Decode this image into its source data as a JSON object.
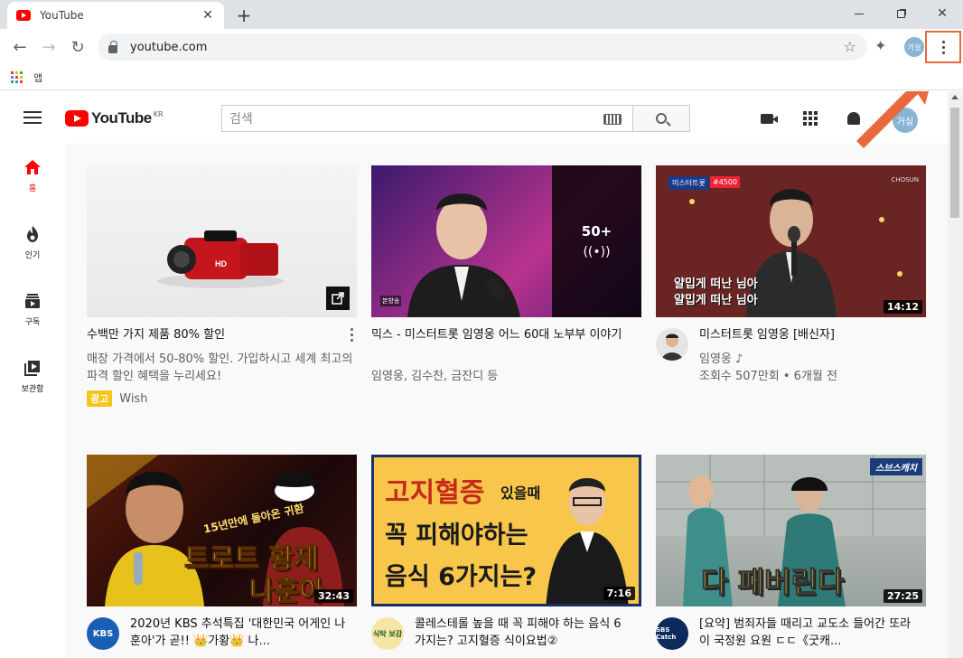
{
  "browser": {
    "tab_title": "YouTube",
    "tab_close": "✕",
    "new_tab": "+",
    "url": "youtube.com",
    "profile_initials": "거실",
    "bookmarks_apps_label": "앱"
  },
  "youtube": {
    "region": "KR",
    "logo_text": "YouTube",
    "search_placeholder": "검색",
    "avatar_initials": "거실",
    "sidebar": [
      {
        "label": "홈"
      },
      {
        "label": "인기"
      },
      {
        "label": "구독"
      },
      {
        "label": "보관함"
      }
    ],
    "videos": [
      {
        "title": "수백만 가지 제품 80% 할인",
        "description": "매장 가격에서 50-80% 할인. 가입하시고 세계 최고의 파격 할인 혜택을 누리세요!",
        "ad_badge": "광고",
        "advertiser": "Wish"
      },
      {
        "title": "믹스 - 미스터트롯 임영웅 어느 60대 노부부 이야기",
        "meta": "임영웅, 김수찬, 금잔디 등",
        "playlist_count": "50+",
        "thumb_tag": "본방송"
      },
      {
        "title": "미스터트롯 임영웅 [배신자]",
        "channel": "임영웅 ♪",
        "meta": "조회수 507만회 • 6개월 전",
        "duration": "14:12",
        "subtitle_1": "얄밉게 떠난 님아",
        "subtitle_2": "얄밉게 떠난 님아",
        "thumb_tag": "CHOSUN",
        "badge": "#4500"
      },
      {
        "title": "2020년 KBS 추석특집 '대한민국 어게인 나훈아'가 곧!! 👑가황👑 나...",
        "duration": "32:43",
        "overlay_1": "15년만에 돌아온 귀환",
        "overlay_2": "트로트 황제",
        "overlay_3": "나훈아",
        "channel_badge": "KBS"
      },
      {
        "title": "콜레스테롤 높을 때 꼭 피해야 하는 음식 6가지는? 고지혈증 식이요법②",
        "duration": "7:16",
        "overlay_1": "고지혈증",
        "overlay_1b": "있을때",
        "overlay_2": "꼭 피해야하는",
        "overlay_3": "음식 6가지는?",
        "channel_badge": "식탁 보감"
      },
      {
        "title": "[요약] 범죄자들 때리고 교도소 들어간 또라이 국정원 요원 ㄷㄷ《굿캐...",
        "duration": "27:25",
        "overlay_1": "다 패버린다",
        "corner_tag": "스브스캐치",
        "channel_badge": "SBS Catch"
      }
    ]
  },
  "colors": {
    "youtube_red": "#ff0000",
    "highlight": "#e8693d",
    "ad_yellow": "#f5c518"
  }
}
